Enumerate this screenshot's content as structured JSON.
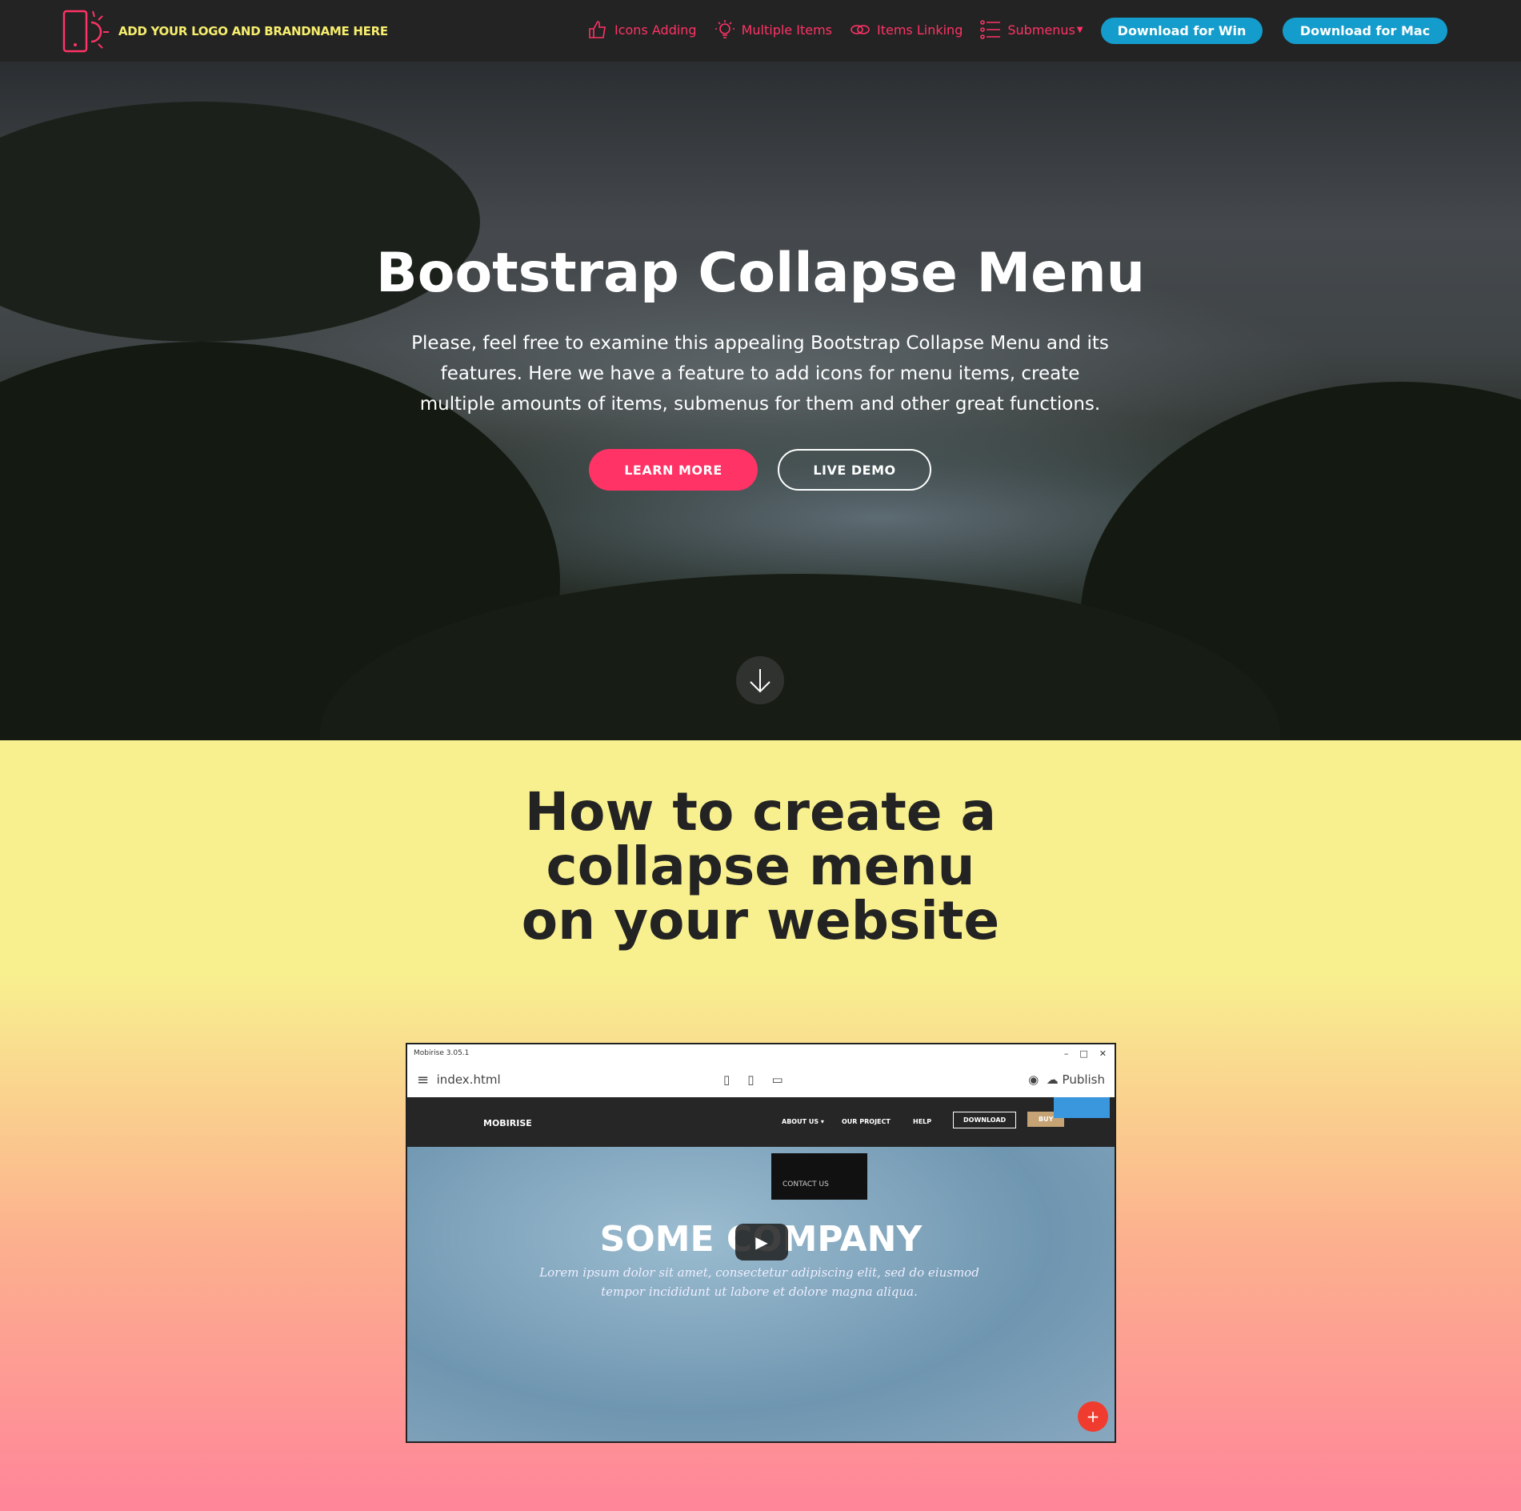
{
  "nav": {
    "brand": "ADD YOUR LOGO AND BRANDNAME HERE",
    "links": [
      {
        "label": "Icons Adding",
        "icon": "thumbs-up-icon"
      },
      {
        "label": "Multiple Items",
        "icon": "lightbulb-icon"
      },
      {
        "label": "Items Linking",
        "icon": "link-icon"
      },
      {
        "label": "Submenus",
        "icon": "list-icon"
      }
    ],
    "download_win": "Download for Win",
    "download_mac": "Download for Mac"
  },
  "hero": {
    "title": "Bootstrap Collapse Menu",
    "text": "Please, feel free to examine this appealing Bootstrap Collapse Menu and its features. Here we have a feature to add icons for menu items, create multiple amounts of items, submenus for them and other great functions.",
    "learn_more": "LEARN MORE",
    "live_demo": "LIVE DEMO"
  },
  "section": {
    "title": "How to create a collapse menu on your website"
  },
  "video": {
    "window_title": "Mobirise 3.05.1",
    "file": "index.html",
    "publish": "Publish",
    "brand": "MOBIRISE",
    "menu": [
      "ABOUT US ▾",
      "OUR PROJECT",
      "HELP"
    ],
    "download": "DOWNLOAD",
    "buy": "BUY",
    "contact": "CONTACT US",
    "headline": "SOME COMPANY",
    "lorem": "Lorem ipsum dolor sit amet, consectetur adipiscing elit, sed do eiusmod tempor incididunt ut labore et dolore magna aliqua."
  },
  "colors": {
    "accent": "#ff3366",
    "brand": "#f7ee6e",
    "button": "#149dcc",
    "nav": "#232323",
    "yellow": "#f8f08f",
    "pink": "#ff8599"
  }
}
